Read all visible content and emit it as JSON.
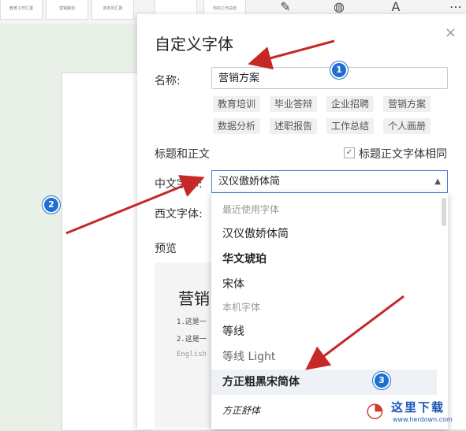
{
  "background": {
    "thumbs": [
      "教育工作汇报",
      "营销策划",
      "商务风汇报",
      "",
      "你的工作总结"
    ],
    "tool_icons": [
      "paint-icon",
      "palette-icon",
      "text-format-icon",
      "more-icon"
    ]
  },
  "dialog": {
    "title": "自定义字体",
    "close_icon": "×",
    "name_label": "名称:",
    "name_value": "营销方案",
    "tags": [
      "教育培训",
      "毕业答辩",
      "企业招聘",
      "营销方案",
      "数据分析",
      "述职报告",
      "工作总结",
      "个人画册"
    ],
    "section_label": "标题和正文",
    "same_font_label": "标题正文字体相同",
    "same_font_checked": true,
    "chinese_font_label": "中文字体:",
    "chinese_font_value": "汉仪傲娇体简",
    "western_font_label": "西文字体:",
    "preview_label": "预览",
    "preview_title": "营销",
    "preview_lines": [
      "1.这是一",
      "2.这是一",
      "English T"
    ]
  },
  "dropdown": {
    "recent_header": "最近使用字体",
    "recent": [
      "汉仪傲娇体简",
      "华文琥珀",
      "宋体"
    ],
    "local_header": "本机字体",
    "local": [
      "等线",
      "等线 Light",
      "方正粗黑宋简体",
      "方正舒体"
    ],
    "selected": "方正粗黑宋简体"
  },
  "annotations": {
    "badge1": "1",
    "badge2": "2",
    "badge3": "3"
  },
  "watermark": {
    "title": "这里下载",
    "url": "www.herdown.com"
  },
  "colors": {
    "arrow": "#c62828",
    "badge": "#1f6fd1",
    "select_border": "#4a7fd6"
  }
}
